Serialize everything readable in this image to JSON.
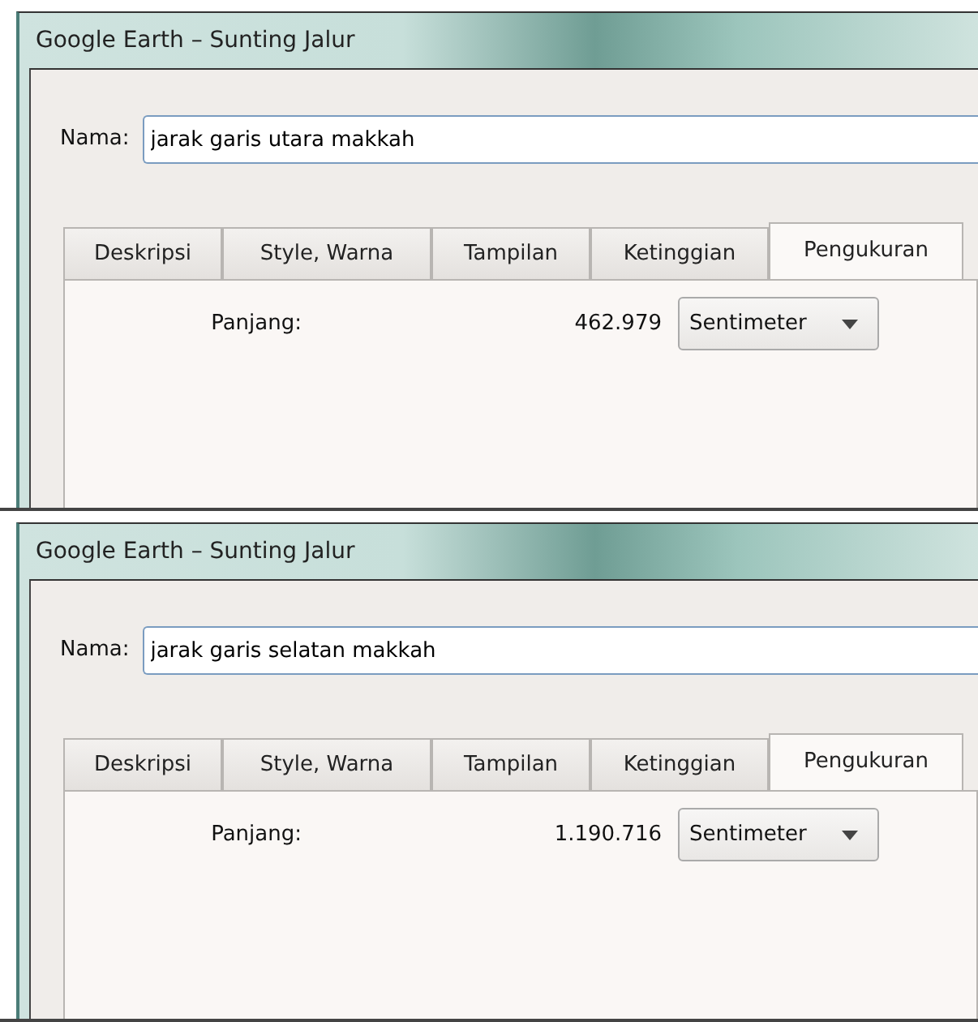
{
  "windows": [
    {
      "title": "Google Earth – Sunting Jalur",
      "name_label": "Nama:",
      "name_value": "jarak garis utara makkah",
      "tabs": [
        {
          "label": "Deskripsi",
          "selected": false
        },
        {
          "label": "Style, Warna",
          "selected": false
        },
        {
          "label": "Tampilan",
          "selected": false
        },
        {
          "label": "Ketinggian",
          "selected": false
        },
        {
          "label": "Pengukuran",
          "selected": true
        }
      ],
      "measurement": {
        "label": "Panjang:",
        "value": "462.979",
        "unit": "Sentimeter"
      }
    },
    {
      "title": "Google Earth – Sunting Jalur",
      "name_label": "Nama:",
      "name_value": "jarak garis selatan makkah",
      "tabs": [
        {
          "label": "Deskripsi",
          "selected": false
        },
        {
          "label": "Style, Warna",
          "selected": false
        },
        {
          "label": "Tampilan",
          "selected": false
        },
        {
          "label": "Ketinggian",
          "selected": false
        },
        {
          "label": "Pengukuran",
          "selected": true
        }
      ],
      "measurement": {
        "label": "Panjang:",
        "value": "1.190.716",
        "unit": "Sentimeter"
      }
    }
  ]
}
